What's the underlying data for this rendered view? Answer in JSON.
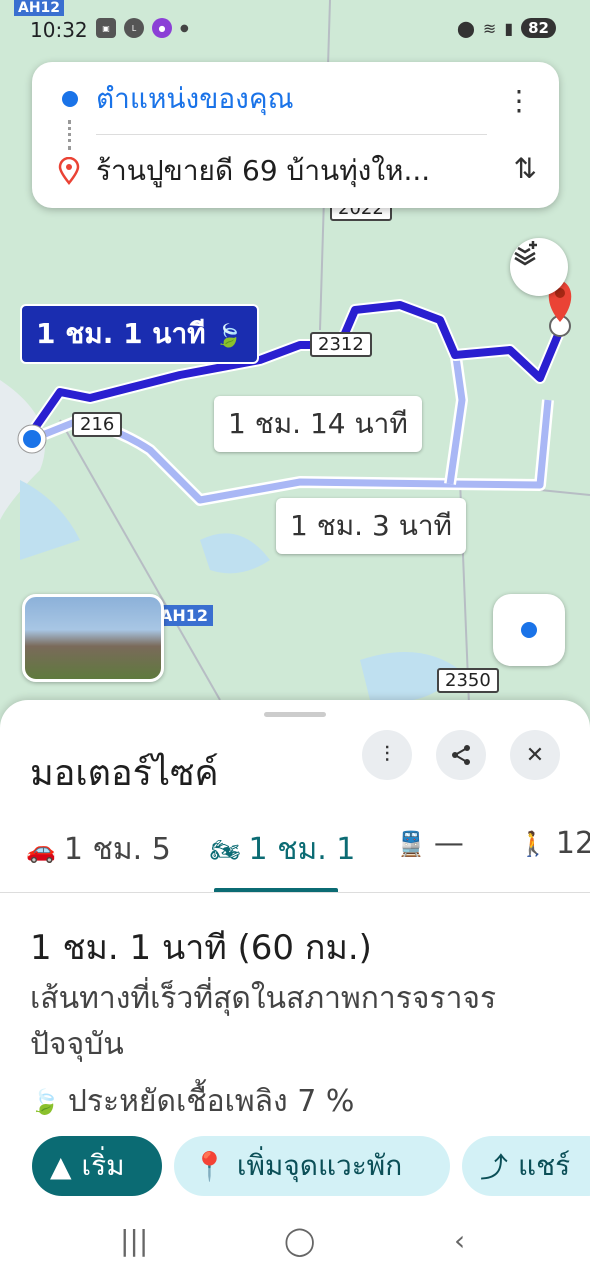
{
  "status_bar": {
    "time": "10:32",
    "highway_tag": "AH12",
    "battery": "82"
  },
  "route_card": {
    "origin": "ตำแหน่งของคุณ",
    "destination": "ร้านปูขายดี 69 บ้านทุ่งให..."
  },
  "map": {
    "main_route_time": "1 ชม. 1 นาที",
    "alt_route_1_time": "1 ชม. 14 นาที",
    "alt_route_2_time": "1 ชม. 3 นาที",
    "road_labels": [
      "2312",
      "216",
      "2022",
      "2350"
    ],
    "highway_label": "AH12"
  },
  "sheet": {
    "title": "มอเตอร์ไซค์",
    "tabs": [
      {
        "mode": "car",
        "label": "1 ชม. 5"
      },
      {
        "mode": "motorcycle",
        "label": "1 ชม. 1"
      },
      {
        "mode": "transit",
        "label": "—"
      },
      {
        "mode": "walk",
        "label": "12"
      }
    ],
    "summary_title": "1 ชม. 1 นาที (60 กม.)",
    "summary_desc": "เส้นทางที่เร็วที่สุดในสภาพการจราจรปัจจุบัน",
    "eco": "ประหยัดเชื้อเพลิง 7 %",
    "actions": {
      "start": "เริ่ม",
      "add_stop": "เพิ่มจุดแวะพัก",
      "share": "แชร์"
    }
  },
  "colors": {
    "route_main": "#2a1fd0",
    "route_alt": "#a9b7f5",
    "accent": "#0b6b73",
    "map_bg": "#cfe9d6"
  }
}
